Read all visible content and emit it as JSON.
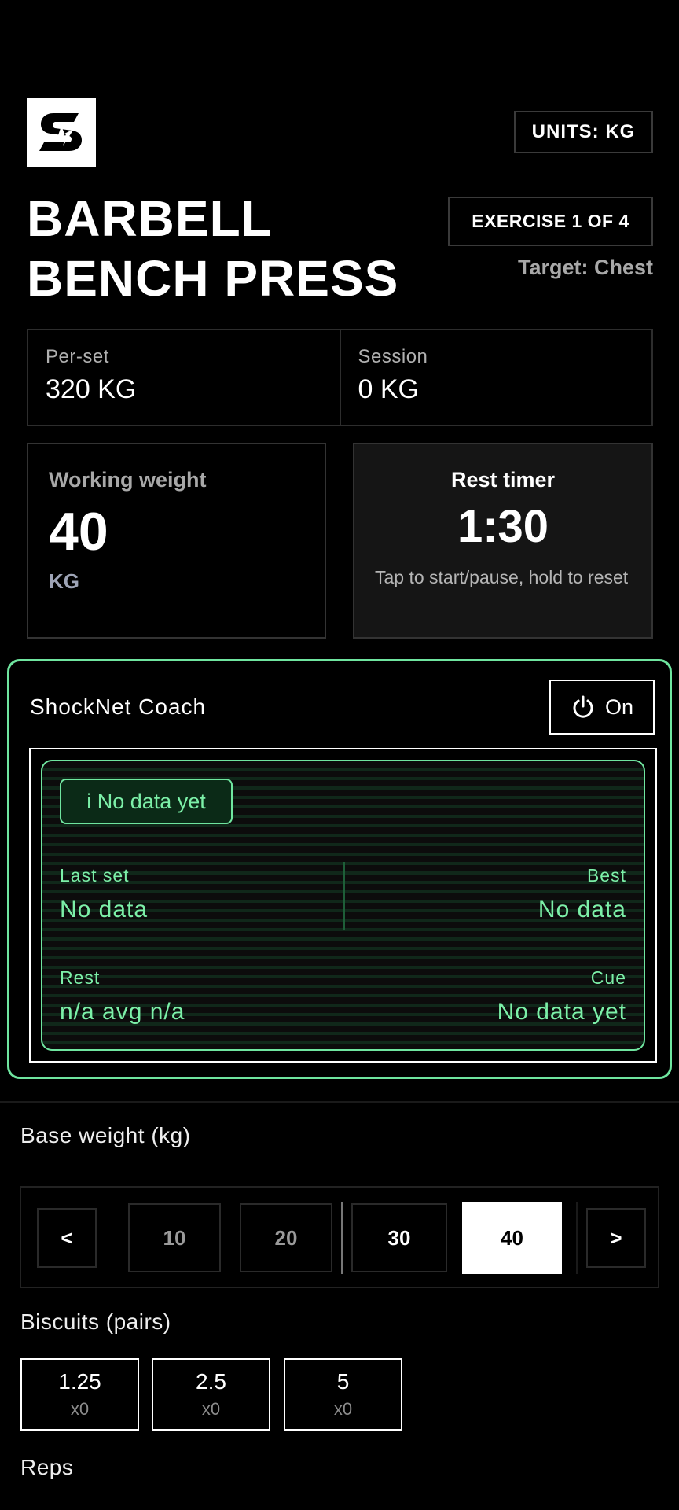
{
  "header": {
    "units_label": "UNITS: KG",
    "exercise_title_line1": "BARBELL",
    "exercise_title_line2": "BENCH PRESS",
    "exercise_progress": "EXERCISE 1 OF 4",
    "target": "Target: Chest"
  },
  "stats": {
    "per_set_label": "Per-set",
    "per_set_value": "320 KG",
    "session_label": "Session",
    "session_value": "0 KG"
  },
  "working_weight": {
    "label": "Working weight",
    "value": "40",
    "unit": "KG"
  },
  "rest_timer": {
    "label": "Rest timer",
    "value": "1:30",
    "hint": "Tap to start/pause, hold to reset"
  },
  "coach": {
    "title": "ShockNet Coach",
    "toggle_label": "On",
    "status_chip": "i No data yet",
    "last_set_label": "Last set",
    "last_set_value": "No data",
    "best_label": "Best",
    "best_value": "No data",
    "rest_label": "Rest",
    "rest_value": "n/a avg n/a",
    "cue_label": "Cue",
    "cue_value": "No data yet",
    "accent_color": "#6fe59f"
  },
  "base_weight": {
    "label": "Base weight (kg)",
    "prev_label": "<",
    "next_label": ">",
    "options": [
      "10",
      "20",
      "30",
      "40"
    ],
    "selected": "40"
  },
  "biscuits": {
    "label": "Biscuits (pairs)",
    "items": [
      {
        "value": "1.25",
        "count": "x0"
      },
      {
        "value": "2.5",
        "count": "x0"
      },
      {
        "value": "5",
        "count": "x0"
      }
    ]
  },
  "reps": {
    "label": "Reps"
  }
}
